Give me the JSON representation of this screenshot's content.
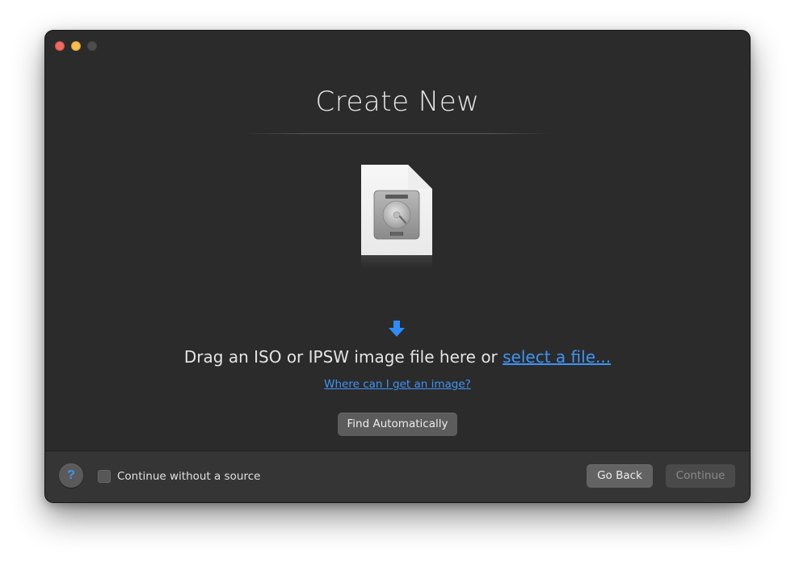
{
  "window": {
    "title": "Create New"
  },
  "drop_zone": {
    "instruction": "Drag an ISO or IPSW image file here or ",
    "select_link": "select a file...",
    "help_link": "Where can I get an image?",
    "find_button": "Find Automatically",
    "file_icon": "hard-disk-image-icon",
    "arrow_icon": "down-arrow-icon"
  },
  "footer": {
    "help_button": "?",
    "checkbox_label": "Continue without a source",
    "checkbox_checked": false,
    "back_button": "Go Back",
    "continue_button": "Continue",
    "continue_enabled": false
  },
  "colors": {
    "background": "#2b2b2b",
    "footer": "#353535",
    "accent": "#3d95f6",
    "close": "#ed6a5e",
    "minimize": "#f5bf4f",
    "zoom_disabled": "#4d4d4d"
  }
}
